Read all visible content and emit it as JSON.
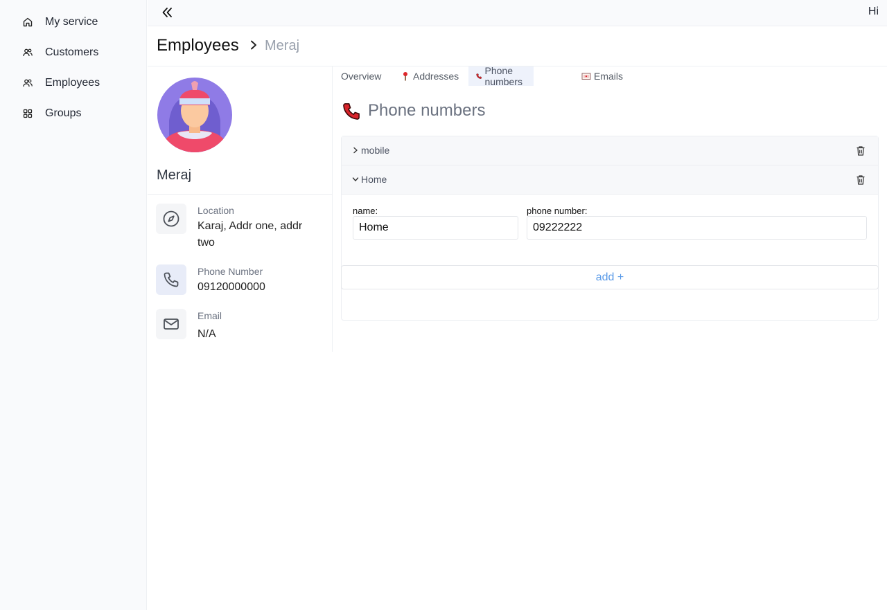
{
  "sidebar": {
    "items": [
      {
        "label": "My service",
        "icon": "home-icon"
      },
      {
        "label": "Customers",
        "icon": "users-icon"
      },
      {
        "label": "Employees",
        "icon": "users-icon"
      },
      {
        "label": "Groups",
        "icon": "grid-icon"
      }
    ]
  },
  "topbar": {
    "greeting": "Hi"
  },
  "breadcrumb": {
    "section": "Employees",
    "current": "Meraj"
  },
  "profile": {
    "name": "Meraj",
    "location": {
      "label": "Location",
      "value": "Karaj, Addr one, addr two"
    },
    "phone": {
      "label": "Phone Number",
      "value": "09120000000"
    },
    "email": {
      "label": "Email",
      "value": "N/A"
    }
  },
  "tabs": [
    {
      "label": "Overview"
    },
    {
      "label": "Addresses",
      "icon": "pushpin-icon"
    },
    {
      "label": "Phone numbers",
      "icon": "telephone-receiver-icon",
      "active": true
    },
    {
      "label": "Emails",
      "icon": "envelope-icon"
    }
  ],
  "section": {
    "title": "Phone numbers"
  },
  "phones": [
    {
      "label": "mobile",
      "expanded": false
    },
    {
      "label": "Home",
      "expanded": true,
      "name_label": "name:",
      "name_value": "Home",
      "number_label": "phone number:",
      "number_value": "09222222"
    }
  ],
  "add_button": {
    "label": "add +"
  },
  "colors": {
    "accent": "#5b9be8",
    "sidebar_bg": "#f9fafc",
    "active_tab_bg": "#eef2fb"
  }
}
